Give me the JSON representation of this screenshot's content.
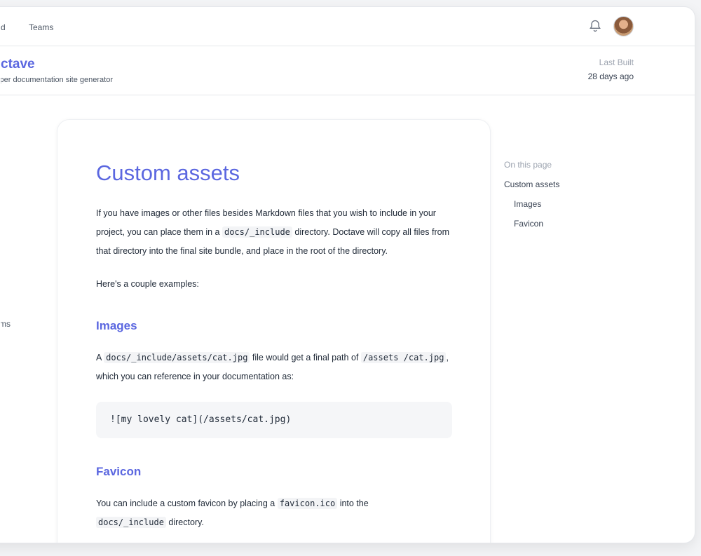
{
  "nav": {
    "item1_partial": "d",
    "item2": "Teams"
  },
  "project": {
    "name_partial": "ctave",
    "description_partial": "loper documentation site generator",
    "last_built_label": "Last Built",
    "last_built_value": "28 days ago"
  },
  "sidebar": {
    "partial_item": "ms"
  },
  "doc": {
    "title": "Custom assets",
    "intro": {
      "part1": "If you have images or other files besides Markdown files that you wish to include in your project, you can place them in a ",
      "code1": "docs/_include",
      "part2": " directory. Doctave will copy all files from that directory into the final site bundle, and place in the root of the directory."
    },
    "examples_text": "Here's a couple examples:",
    "images_heading": "Images",
    "images_para": {
      "part1": "A ",
      "code1": "docs/_include/assets/cat.jpg",
      "part2": " file would get a final path of ",
      "code2": "/assets /cat.jpg",
      "part3": ", which you can reference in your documentation as:"
    },
    "code_example": "![my lovely cat](/assets/cat.jpg)",
    "favicon_heading": "Favicon",
    "favicon_para": {
      "part1": "You can include a custom favicon by placing a ",
      "code1": "favicon.ico",
      "part2": " into the ",
      "code2": "docs/_include",
      "part3": " directory."
    }
  },
  "toc": {
    "heading": "On this page",
    "items": [
      "Custom assets",
      "Images",
      "Favicon"
    ]
  },
  "icons": {
    "bell": "bell-icon",
    "avatar": "avatar"
  },
  "colors": {
    "accent": "#5b67e0",
    "border": "#e5e7eb"
  }
}
